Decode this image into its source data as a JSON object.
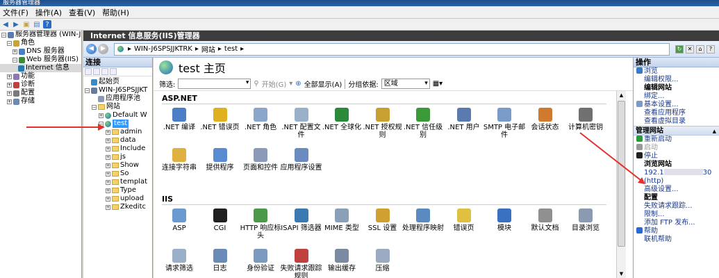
{
  "window": {
    "title": "服务器管理器"
  },
  "menu": [
    "文件(F)",
    "操作(A)",
    "查看(V)",
    "帮助(H)"
  ],
  "left_tree": [
    {
      "label": "服务器管理器 (WIN-J",
      "level": 0,
      "pm": "−"
    },
    {
      "label": "角色",
      "level": 1,
      "pm": "−"
    },
    {
      "label": "DNS 服务器",
      "level": 2,
      "pm": "+"
    },
    {
      "label": "Web 服务器(IIS)",
      "level": 2,
      "pm": "−"
    },
    {
      "label": "Internet 信息",
      "level": 3,
      "pm": ""
    },
    {
      "label": "功能",
      "level": 1,
      "pm": "+"
    },
    {
      "label": "诊断",
      "level": 1,
      "pm": "+"
    },
    {
      "label": "配置",
      "level": 1,
      "pm": "+"
    },
    {
      "label": "存储",
      "level": 1,
      "pm": "+"
    }
  ],
  "iis_title": "Internet 信息服务(IIS)管理器",
  "address": {
    "parts": [
      "WIN-J6SPSJJKTRK",
      "网站",
      "test"
    ]
  },
  "connections": {
    "header": "连接",
    "tree": [
      {
        "label": "起始页",
        "level": 0,
        "icon": "start"
      },
      {
        "label": "WIN-J6SPSJJKT",
        "level": 0,
        "icon": "server",
        "pm": "−"
      },
      {
        "label": "应用程序池",
        "level": 1,
        "icon": "pool"
      },
      {
        "label": "网站",
        "level": 1,
        "icon": "folder",
        "pm": "−"
      },
      {
        "label": "Default W",
        "level": 2,
        "icon": "globe",
        "pm": "+"
      },
      {
        "label": "test",
        "level": 2,
        "icon": "globe",
        "pm": "−",
        "selected": true
      },
      {
        "label": "admin",
        "level": 3,
        "icon": "folder",
        "pm": "+"
      },
      {
        "label": "data",
        "level": 3,
        "icon": "folder",
        "pm": "+"
      },
      {
        "label": "Include",
        "level": 3,
        "icon": "folder",
        "pm": "+"
      },
      {
        "label": "js",
        "level": 3,
        "icon": "folder",
        "pm": "+"
      },
      {
        "label": "Show",
        "level": 3,
        "icon": "folder",
        "pm": "+"
      },
      {
        "label": "So",
        "level": 3,
        "icon": "folder",
        "pm": "+"
      },
      {
        "label": "templat",
        "level": 3,
        "icon": "folder",
        "pm": "+"
      },
      {
        "label": "Type",
        "level": 3,
        "icon": "folder",
        "pm": "+"
      },
      {
        "label": "upload",
        "level": 3,
        "icon": "folder",
        "pm": "+"
      },
      {
        "label": "Zkeditc",
        "level": 3,
        "icon": "folder",
        "pm": "+"
      }
    ]
  },
  "main": {
    "title": "test 主页",
    "filter_label": "筛选:",
    "start_label": "开始(G)",
    "showall_label": "全部显示(A)",
    "group_label": "分组依据:",
    "group_value": "区域",
    "sections": [
      {
        "title": "ASP.NET",
        "items": [
          {
            "label": ".NET 编译",
            "color": "#4a7fc7"
          },
          {
            "label": ".NET 错误页",
            "color": "#e0b020"
          },
          {
            "label": ".NET 角色",
            "color": "#8aa6c8"
          },
          {
            "label": ".NET 配置文件",
            "color": "#9ab0c8"
          },
          {
            "label": ".NET 全球化",
            "color": "#2a8a3a"
          },
          {
            "label": ".NET 授权规则",
            "color": "#c8a030"
          },
          {
            "label": ".NET 信任级别",
            "color": "#3a9a3a"
          },
          {
            "label": ".NET 用户",
            "color": "#5a7ab0"
          },
          {
            "label": "SMTP 电子邮件",
            "color": "#7a9ac8"
          },
          {
            "label": "会话状态",
            "color": "#d07a30"
          },
          {
            "label": "计算机密钥",
            "color": "#707070"
          },
          {
            "label": "连接字符串",
            "color": "#e0b040"
          },
          {
            "label": "提供程序",
            "color": "#5a8ad0"
          },
          {
            "label": "页面和控件",
            "color": "#8a9ab8"
          },
          {
            "label": "应用程序设置",
            "color": "#6a8ac0"
          }
        ]
      },
      {
        "title": "IIS",
        "items": [
          {
            "label": "ASP",
            "color": "#6a9ad0"
          },
          {
            "label": "CGI",
            "color": "#202020"
          },
          {
            "label": "HTTP 响应标头",
            "color": "#4a9a4a"
          },
          {
            "label": "ISAPI 筛选器",
            "color": "#3a7ab0"
          },
          {
            "label": "MIME 类型",
            "color": "#8aa0b8"
          },
          {
            "label": "SSL 设置",
            "color": "#d0a030"
          },
          {
            "label": "处理程序映射",
            "color": "#5a8ac0"
          },
          {
            "label": "错误页",
            "color": "#e0c040"
          },
          {
            "label": "模块",
            "color": "#3a70c0"
          },
          {
            "label": "默认文档",
            "color": "#909090"
          },
          {
            "label": "目录浏览",
            "color": "#8a9ab0"
          },
          {
            "label": "请求筛选",
            "color": "#9ab0c8"
          },
          {
            "label": "日志",
            "color": "#6a8ab8"
          },
          {
            "label": "身份验证",
            "color": "#7a9ac0"
          },
          {
            "label": "失败请求跟踪规则",
            "color": "#c04040"
          },
          {
            "label": "输出缓存",
            "color": "#7a8aa0"
          },
          {
            "label": "压缩",
            "color": "#9aaac0"
          }
        ]
      }
    ]
  },
  "actions": {
    "header": "操作",
    "items": [
      {
        "type": "link",
        "label": "浏览",
        "icon": "#3a7ac0"
      },
      {
        "type": "link",
        "label": "编辑权限..."
      },
      {
        "type": "bold",
        "label": "编辑网站"
      },
      {
        "type": "link",
        "label": "绑定..."
      },
      {
        "type": "link",
        "label": "基本设置...",
        "icon": "#7a9ac8"
      },
      {
        "type": "link",
        "label": "查看应用程序"
      },
      {
        "type": "link",
        "label": "查看虚拟目录"
      },
      {
        "type": "sub",
        "label": "管理网站"
      },
      {
        "type": "link",
        "label": "重新启动",
        "icon": "#2a9a3a"
      },
      {
        "type": "dis",
        "label": "启动",
        "icon": "#9a9a9a"
      },
      {
        "type": "link",
        "label": "停止",
        "icon": "#202020"
      },
      {
        "type": "bold",
        "label": "浏览网站"
      },
      {
        "type": "blur",
        "label": "192.1",
        "suffix": "30"
      },
      {
        "type": "link",
        "label": "(http)"
      },
      {
        "type": "link",
        "label": "高级设置..."
      },
      {
        "type": "bold",
        "label": "配置"
      },
      {
        "type": "link",
        "label": "失败请求跟踪..."
      },
      {
        "type": "link",
        "label": "限制..."
      },
      {
        "type": "link",
        "label": "添加 FTP 发布..."
      },
      {
        "type": "link",
        "label": "帮助",
        "icon": "#2a6ad0"
      },
      {
        "type": "link",
        "label": "联机帮助"
      }
    ]
  },
  "colors": {
    "annotation_arrow": "#e2322d",
    "selection": "#3399ff"
  }
}
